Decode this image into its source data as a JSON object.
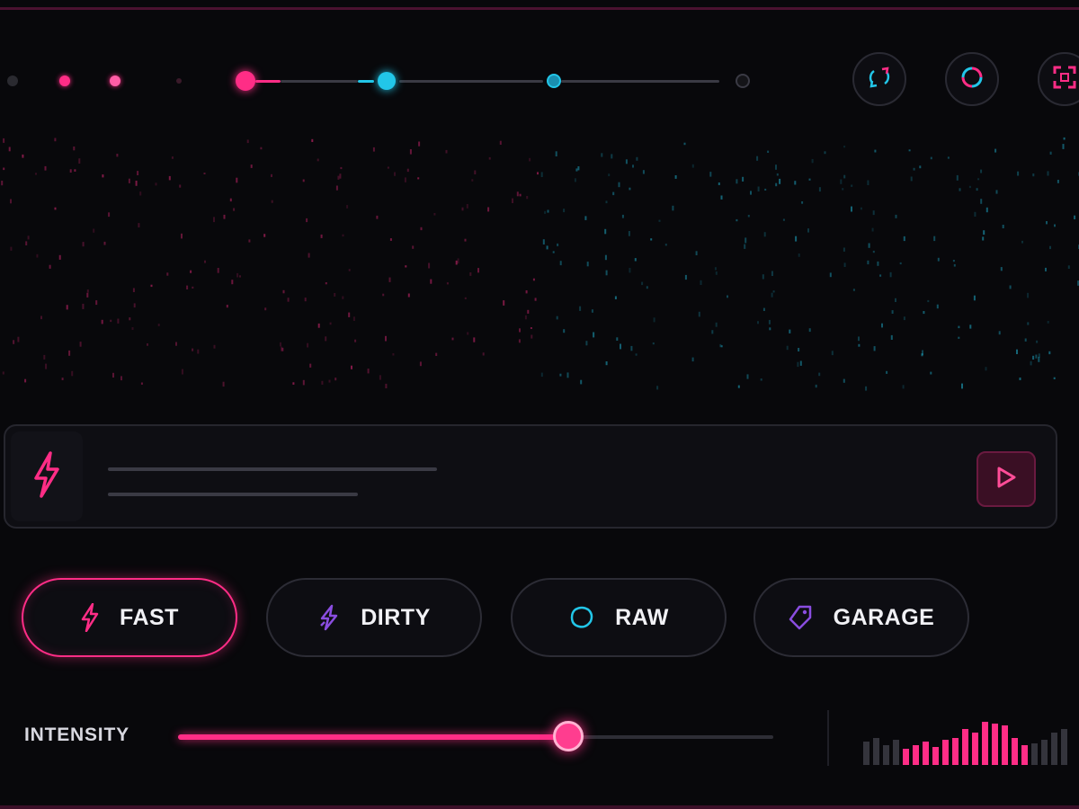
{
  "colors": {
    "accent_pink": "#ff2d86",
    "accent_cyan": "#22c6e8",
    "accent_purple": "#8a4de0",
    "background": "#08080b"
  },
  "top_controls": {
    "buttons": [
      {
        "icon": "shuffle-icon"
      },
      {
        "icon": "loop-icon"
      },
      {
        "icon": "expand-icon"
      }
    ]
  },
  "prompt_panel": {
    "icon": "bolt-icon",
    "play_icon": "play-icon"
  },
  "styles": [
    {
      "label": "FAST",
      "icon": "bolt-icon",
      "active": true
    },
    {
      "label": "DIRTY",
      "icon": "bolt-alt-icon",
      "active": false
    },
    {
      "label": "RAW",
      "icon": "blob-icon",
      "active": false
    },
    {
      "label": "GARAGE",
      "icon": "tag-icon",
      "active": false
    }
  ],
  "intensity": {
    "label": "INTENSITY",
    "value": 0.656
  }
}
